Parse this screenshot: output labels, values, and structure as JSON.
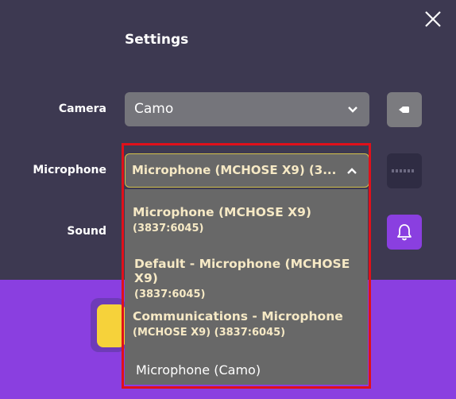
{
  "dialog": {
    "title": "Settings"
  },
  "camera": {
    "label": "Camera",
    "selected": "Camo"
  },
  "microphone": {
    "label": "Microphone",
    "selected": "Microphone (MCHOSE X9) (3...",
    "options": [
      {
        "line1": "Microphone (MCHOSE X9)",
        "line2": "(3837:6045)"
      },
      {
        "line1": "Default - Microphone (MCHOSE X9)",
        "line2": "(3837:6045)"
      },
      {
        "line1": "Communications - Microphone",
        "line2": "(MCHOSE X9) (3837:6045)"
      },
      {
        "line1": "Microphone (Camo)",
        "line2": ""
      }
    ]
  },
  "sound": {
    "label": "Sound"
  },
  "icons": {
    "close": "close-icon",
    "chevron_down": "chevron-down-icon",
    "chevron_up": "chevron-up-icon",
    "camera_preview": "video-camera-icon",
    "mic_level": "audio-level-icon",
    "bell": "bell-icon"
  },
  "colors": {
    "panel_bg": "#3d3951",
    "page_bg": "#8a3fe0",
    "accent_purple": "#8a3fe0",
    "highlight_red": "#e0101a",
    "active_border": "#d2c14a"
  }
}
